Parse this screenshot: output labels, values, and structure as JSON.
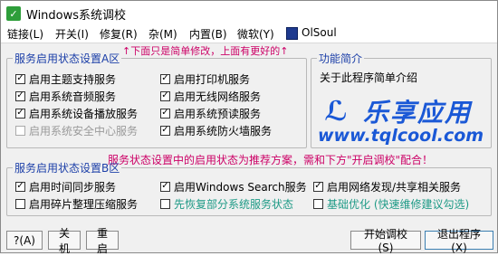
{
  "window": {
    "title": "Windows系统调校"
  },
  "menubar": {
    "items": [
      "链接(L)",
      "开关(I)",
      "修复(R)",
      "杂(M)",
      "内置(B)",
      "微软(Y)",
      "OlSoul"
    ]
  },
  "tip": "↑下面只是简单修改，上面有更好的↑",
  "group_a": {
    "title": "服务启用状态设置A区",
    "left": [
      {
        "label": "启用主题支持服务",
        "checked": true
      },
      {
        "label": "启用系统音频服务",
        "checked": true
      },
      {
        "label": "启用系统设备播放服务",
        "checked": true
      },
      {
        "label": "启用系统安全中心服务",
        "checked": false,
        "disabled": true
      }
    ],
    "right": [
      {
        "label": "启用打印机服务",
        "checked": true
      },
      {
        "label": "启用无线网络服务",
        "checked": true
      },
      {
        "label": "启用系统预读服务",
        "checked": true
      },
      {
        "label": "启用系统防火墙服务",
        "checked": true
      }
    ]
  },
  "about": {
    "title": "功能简介",
    "text": "关于此程序简单介绍",
    "logo_text": "乐享应用",
    "logo_url": "www.tqlcool.com"
  },
  "note": "服务状态设置中的启用状态为推荐方案，需和下方\"开启调校\"配合！",
  "group_b": {
    "title": "服务启用状态设置B区",
    "row1": [
      {
        "label": "启用时间同步服务",
        "checked": true
      },
      {
        "label": "启用Windows Search服务",
        "checked": true
      },
      {
        "label": "启用网络发现/共享相关服务",
        "checked": true
      }
    ],
    "row2": [
      {
        "label": "启用碎片整理压缩服务",
        "checked": false
      },
      {
        "label": "先恢复部分系统服务状态",
        "checked": false,
        "green": true
      },
      {
        "label": "基础优化 (快速维修建议勾选)",
        "checked": false,
        "green": true
      }
    ]
  },
  "buttons": {
    "help": "?(A)",
    "shutdown": "关机",
    "restart": "重启",
    "start": "开始调校(S)",
    "exit": "退出程序(X)"
  }
}
